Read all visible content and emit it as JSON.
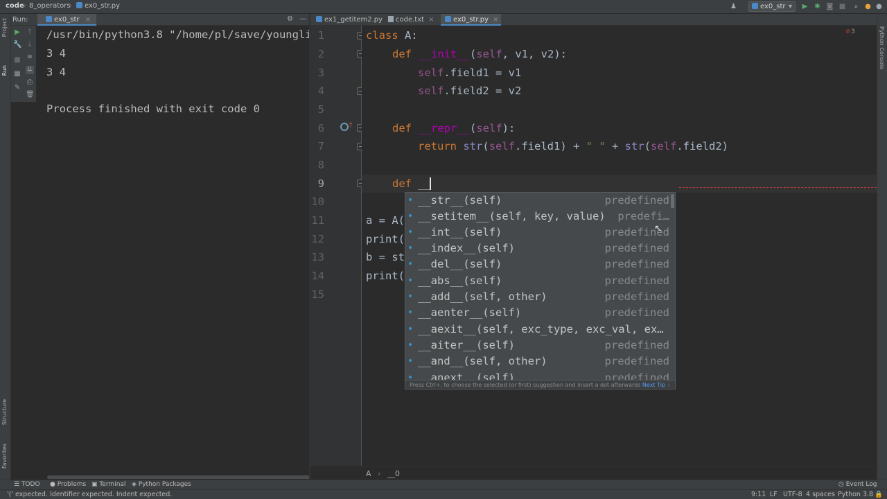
{
  "titlebar": {
    "project": "code",
    "crumb1": "8_operators",
    "crumb2": "ex0_str.py",
    "run_config": "ex0_str"
  },
  "left_tabs": {
    "project": "Project",
    "run": "Run",
    "structure": "Structure",
    "favorites": "Favorites"
  },
  "right_tabs": {
    "python_console": "Python Console"
  },
  "run_panel": {
    "label": "Run:",
    "tab": "ex0_str",
    "output": [
      "/usr/bin/python3.8 \"/home/pl/save/youngli",
      "3 4",
      "3 4",
      "",
      "Process finished with exit code 0"
    ]
  },
  "editor_tabs": [
    {
      "label": "ex1_getitem2.py",
      "icon": "python-file-icon"
    },
    {
      "label": "code.txt",
      "icon": "text-file-icon"
    },
    {
      "label": "ex0_str.py",
      "icon": "python-file-icon"
    }
  ],
  "line_numbers": [
    "1",
    "2",
    "3",
    "4",
    "5",
    "6",
    "7",
    "8",
    "9",
    "10",
    "11",
    "12",
    "13",
    "14",
    "15"
  ],
  "code_lines": {
    "l1_kw": "class",
    "l1_rest": " A:",
    "l2_kw": "def",
    "l2_fn": "__init__",
    "l2_open": "(",
    "l2_self": "self",
    "l2_rest": ", v1, v2):",
    "l3_self": "self",
    "l3_rest": ".field1 = v1",
    "l4_self": "self",
    "l4_rest": ".field2 = v2",
    "l6_kw": "def",
    "l6_fn": "__repr__",
    "l6_open": "(",
    "l6_self": "self",
    "l6_rest": "):",
    "l7_kw": "return",
    "l7_bi1": "str",
    "l7_a": "(",
    "l7_self1": "self",
    "l7_b": ".field1) + ",
    "l7_str": "\" \"",
    "l7_c": " + ",
    "l7_bi2": "str",
    "l7_d": "(",
    "l7_self2": "self",
    "l7_e": ".field2)",
    "l9_kw": "def",
    "l9_rest": " __",
    "l11": "a = A(",
    "l12": "print(",
    "l13": "b = st",
    "l14": "print("
  },
  "inspection_count": "3",
  "completion": {
    "items": [
      {
        "name": "__str__(self)",
        "type": "predefined"
      },
      {
        "name": "__setitem__(self, key, value)",
        "type": "predefi…"
      },
      {
        "name": "__int__(self)",
        "type": "predefined"
      },
      {
        "name": "__index__(self)",
        "type": "predefined"
      },
      {
        "name": "__del__(self)",
        "type": "predefined"
      },
      {
        "name": "__abs__(self)",
        "type": "predefined"
      },
      {
        "name": "__add__(self, other)",
        "type": "predefined"
      },
      {
        "name": "__aenter__(self)",
        "type": "predefined"
      },
      {
        "name": "__aexit__(self, exc_type, exc_val, ex…",
        "type": ""
      },
      {
        "name": "__aiter__(self)",
        "type": "predefined"
      },
      {
        "name": "__and__(self, other)",
        "type": "predefined"
      },
      {
        "name": "__anext__(self)",
        "type": "predefined"
      }
    ],
    "footer_hint": "Press Ctrl+. to choose the selected (or first) suggestion and insert a dot afterwards",
    "footer_link": "Next Tip"
  },
  "editor_breadcrumb": {
    "cls": "A",
    "sep": "›",
    "member": "__0"
  },
  "bottom_tools": [
    "TODO",
    "Problems",
    "Terminal",
    "Python Packages"
  ],
  "event_log": "Event Log",
  "status": {
    "message": "'(' expected. Identifier expected. Indent expected.",
    "position": "9:11",
    "line_sep": "LF",
    "encoding": "UTF-8",
    "indent": "4 spaces",
    "interpreter": "Python 3.8"
  },
  "colors": {
    "accent": "#4a88c7",
    "keyword": "#cc7832",
    "dunder": "#b200b2",
    "self": "#94558d",
    "error": "#bc3f3c"
  }
}
